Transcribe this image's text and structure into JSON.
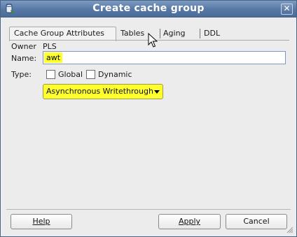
{
  "window": {
    "title": "Create cache group",
    "close_glyph": "✕",
    "icon": "cache-app-icon"
  },
  "tabs": [
    {
      "label": "Cache Group Attributes",
      "active": true
    },
    {
      "label": "Tables",
      "active": false
    },
    {
      "label": "Aging",
      "active": false
    },
    {
      "label": "DDL",
      "active": false
    }
  ],
  "form": {
    "owner_label": "Owner",
    "owner_value": "PLS",
    "name_label": "Name:",
    "name_value": "awt",
    "type_label": "Type:",
    "global_label": "Global",
    "global_checked": false,
    "dynamic_label": "Dynamic",
    "dynamic_checked": false,
    "cache_type_selected": "Asynchronous Writethrough"
  },
  "buttons": {
    "help": "Help",
    "apply": "Apply",
    "cancel": "Cancel"
  },
  "colors": {
    "highlight": "#ffff2e",
    "titlebar": "#5677a4"
  }
}
